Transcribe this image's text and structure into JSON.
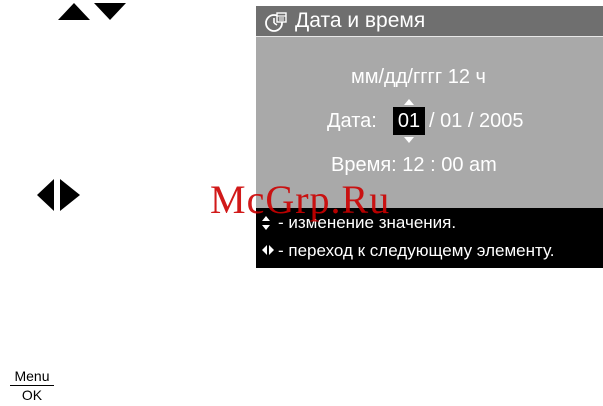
{
  "manual": {
    "up_down_icon": "up-down-arrows",
    "left_right_icon": "left-right-arrows",
    "menu_label": "Menu",
    "ok_label": "OK"
  },
  "screen": {
    "title_icon": "clock-calendar-icon",
    "title": "Дата и время",
    "format_line": "мм/дд/гггг  12 ч",
    "date_label": "Дата:",
    "date_month": "01",
    "date_rest": "/ 01 / 2005",
    "time_line": "Время:  12 : 00  am",
    "hints": [
      {
        "icon": "up-down-arrows",
        "text": " - изменение значения."
      },
      {
        "icon": "left-right-arrows",
        "text": " - переход к следующему элементу."
      }
    ]
  },
  "watermark": "McGrp.Ru",
  "colors": {
    "screen_bg": "#a9a9a9",
    "title_bg": "#6f6f6f",
    "hint_bg": "#000000",
    "watermark": "#cc0000"
  }
}
